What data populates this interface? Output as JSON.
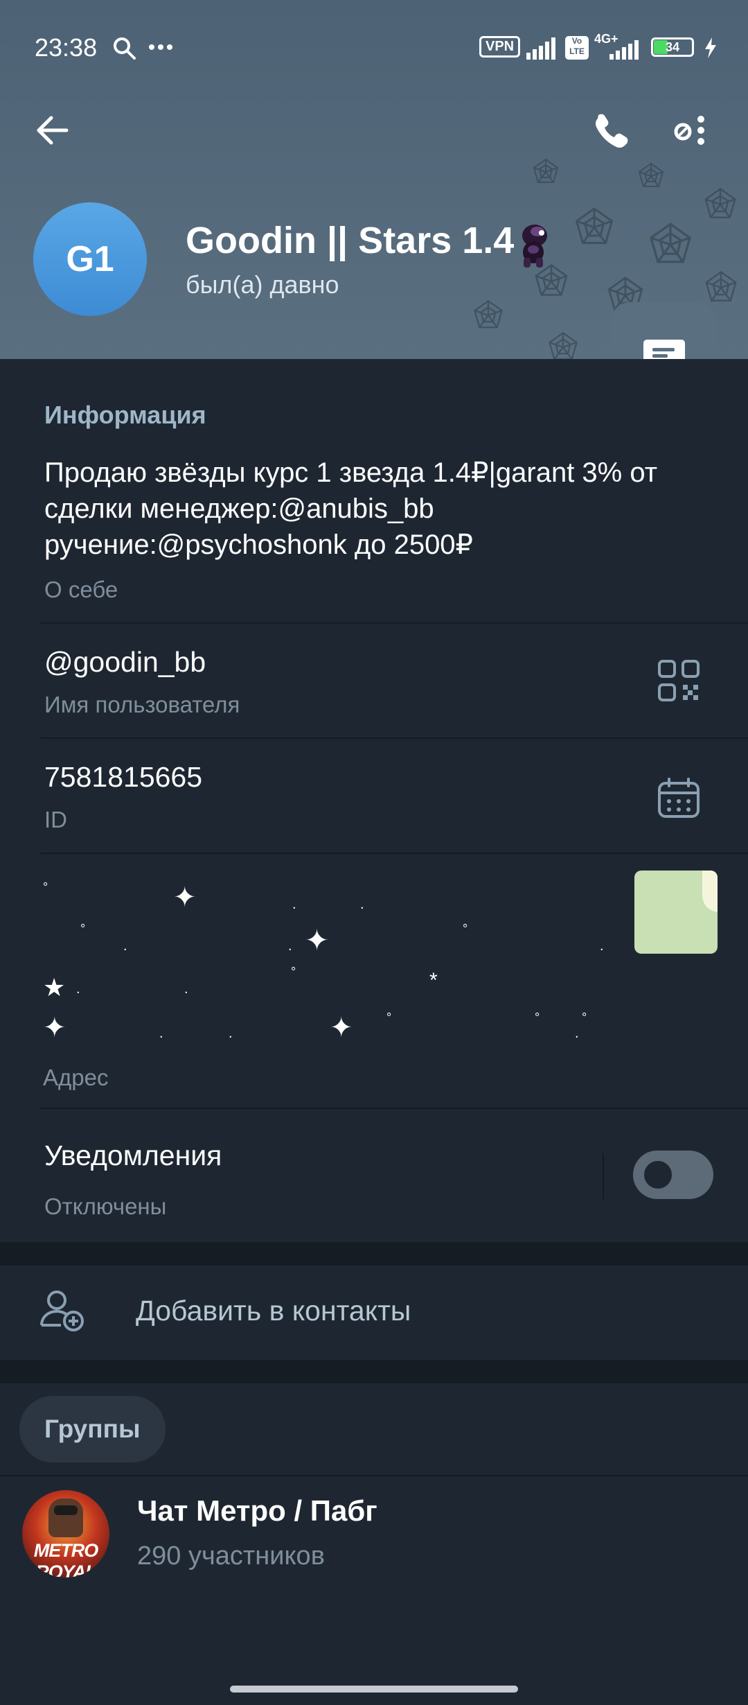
{
  "status_bar": {
    "time": "23:38",
    "vpn_label": "VPN",
    "network_label": "4G+",
    "volte_label": "Vo LTE",
    "battery": "34"
  },
  "header": {
    "avatar_initials": "G1",
    "name": "Goodin || Stars 1.4",
    "last_seen": "был(а) давно",
    "icons": [
      "back-arrow-icon",
      "phone-icon",
      "more-options-icon",
      "message-icon"
    ]
  },
  "info": {
    "section_title": "Информация",
    "bio": "Продаю звёзды курс 1 звезда 1.4₽|garant 3% от сделки менеджер:@anubis_bb ручение:@psychoshonk до 2500₽",
    "bio_label": "О себе",
    "username": "@goodin_bb",
    "username_label": "Имя пользователя",
    "id": "7581815665",
    "id_label": "ID",
    "address_label": "Адрес",
    "notifications_title": "Уведомления",
    "notifications_value": "Отключены",
    "notifications_enabled": false
  },
  "actions": {
    "add_contact": "Добавить в контакты"
  },
  "groups": {
    "tab_label": "Группы",
    "items": [
      {
        "name": "Чат Метро / Пабг",
        "members": "290 участников",
        "avatar_text": "METRO ROYAL"
      }
    ]
  }
}
